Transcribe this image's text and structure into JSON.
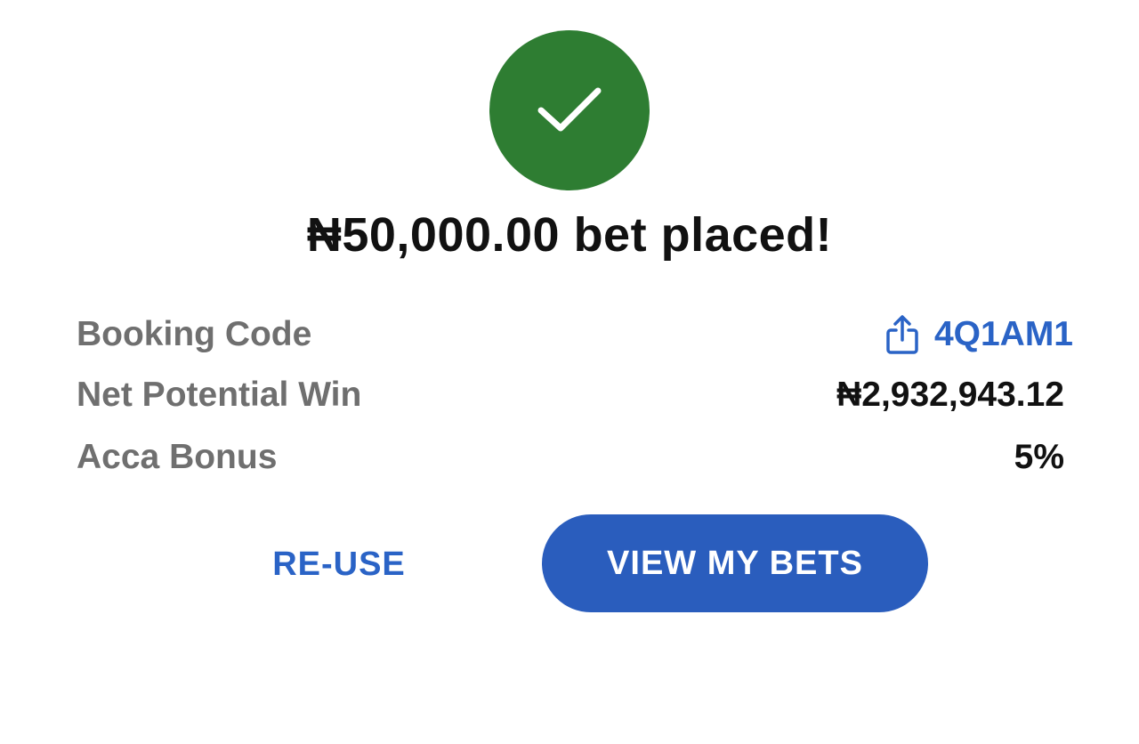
{
  "confirmation": {
    "icon": "check-icon",
    "success_color": "#2e7d32",
    "title": "₦50,000.00 bet placed!"
  },
  "details": {
    "booking_code": {
      "label": "Booking Code",
      "value": "4Q1AM1",
      "icon": "share-icon"
    },
    "net_potential_win": {
      "label": "Net Potential Win",
      "value": "₦2,932,943.12"
    },
    "acca_bonus": {
      "label": "Acca Bonus",
      "value": "5%"
    }
  },
  "actions": {
    "reuse_label": "RE-USE",
    "view_bets_label": "VIEW MY BETS",
    "accent_color": "#2a63c6"
  }
}
